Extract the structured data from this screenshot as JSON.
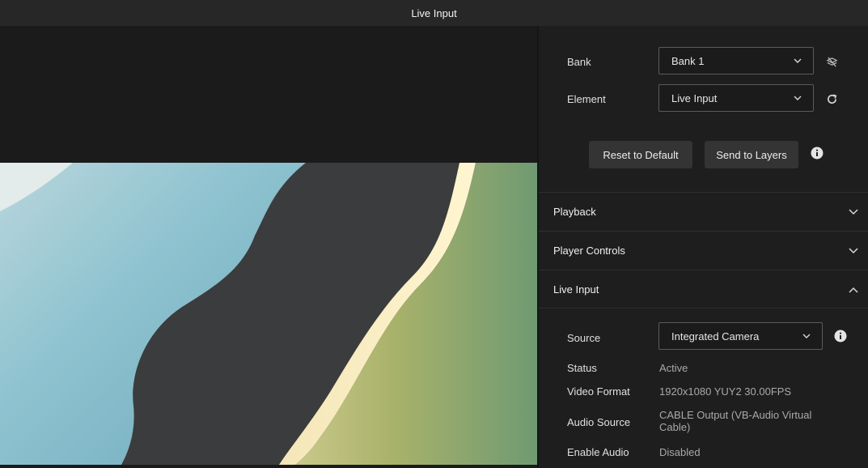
{
  "window": {
    "title": "Live Input"
  },
  "controls": {
    "bank": {
      "label": "Bank",
      "value": "Bank 1"
    },
    "element": {
      "label": "Element",
      "value": "Live Input"
    },
    "reset_label": "Reset to Default",
    "send_label": "Send to Layers"
  },
  "sections": [
    {
      "label": "Playback",
      "expanded": false
    },
    {
      "label": "Player Controls",
      "expanded": false
    },
    {
      "label": "Live Input",
      "expanded": true
    }
  ],
  "live_input": {
    "source": {
      "label": "Source",
      "value": "Integrated Camera"
    },
    "status": {
      "label": "Status",
      "value": "Active"
    },
    "video_format": {
      "label": "Video Format",
      "value": "1920x1080 YUY2 30.00FPS"
    },
    "audio_source": {
      "label": "Audio Source",
      "value_line1": "CABLE Output (VB-Audio Virtual",
      "value_line2": "Cable)"
    },
    "enable_audio": {
      "label": "Enable Audio",
      "value": "Disabled"
    }
  },
  "icons": {
    "bank_side": "hide-layers-icon",
    "element_side": "refresh-icon",
    "info": "info-icon",
    "chevron": "chevron-down-icon",
    "chevron_up": "chevron-up-icon"
  },
  "colors": {
    "background": "#1b1b1b",
    "panel": "#1e1e1e",
    "titlebar": "#272727",
    "button": "#343434"
  }
}
